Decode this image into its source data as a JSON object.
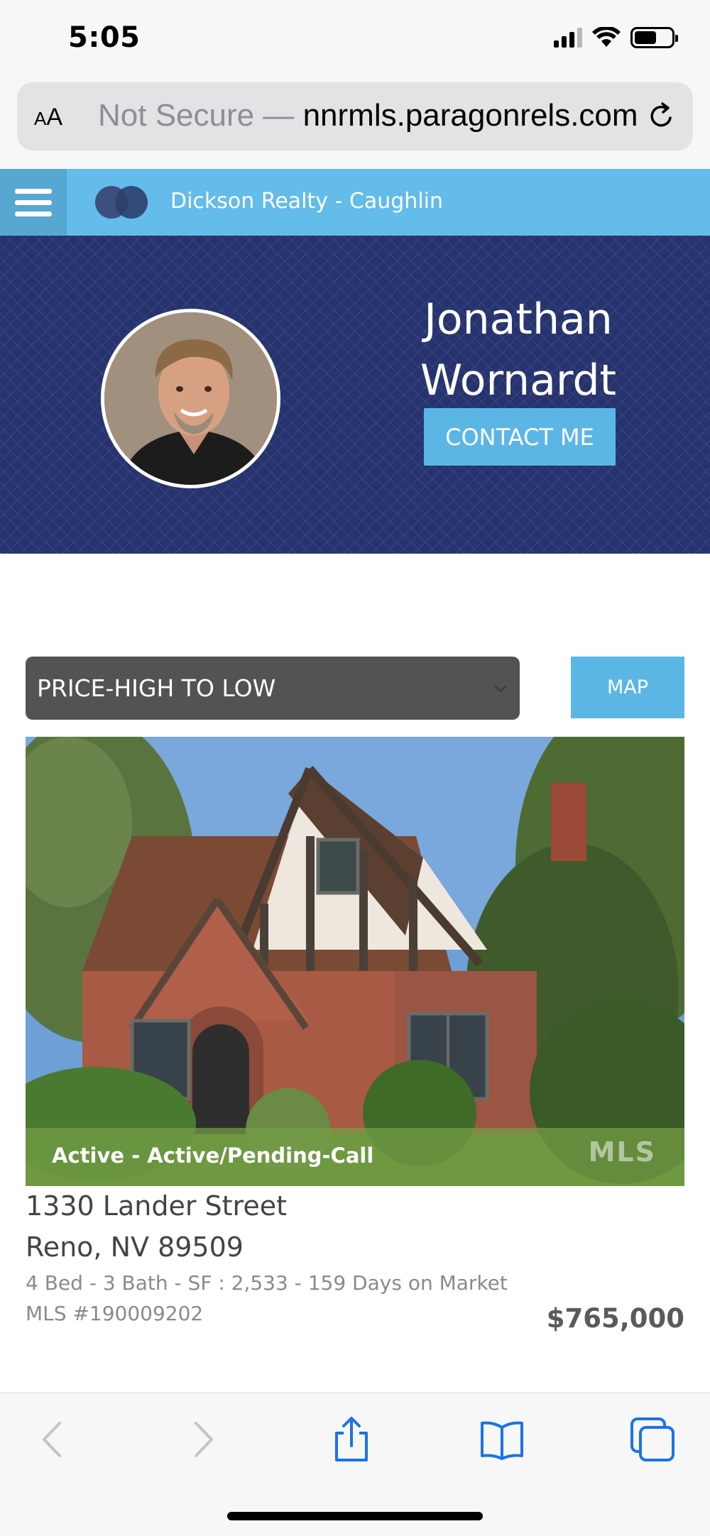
{
  "status_bar": {
    "time": "5:05"
  },
  "browser": {
    "text_size_label_small": "A",
    "text_size_label_large": "A",
    "security_label": "Not Secure —",
    "domain": "nnrmls.paragonrels.com"
  },
  "brand": {
    "name": "Dickson Realty - Caughlin"
  },
  "agent": {
    "name_line1": "Jonathan",
    "name_line2": "Wornardt",
    "contact_label": "CONTACT ME"
  },
  "controls": {
    "sort_value": "PRICE-HIGH TO LOW",
    "map_label": "MAP"
  },
  "listing": {
    "status": "Active - Active/Pending-Call",
    "watermark": "MLS",
    "address_line1": "1330 Lander Street",
    "address_line2": "Reno, NV 89509",
    "details": "4  Bed - 3  Bath - SF : 2,533 - 159 Days on Market",
    "mls_number": "MLS #190009202",
    "price": "$765,000"
  },
  "colors": {
    "brand_bar": "#63bce9",
    "hero_bg": "#26336e",
    "accent_button": "#5bb6e5",
    "ios_blue": "#1a73e8"
  },
  "icons": {
    "toolbar": [
      "back-icon",
      "forward-icon",
      "share-icon",
      "bookmarks-icon",
      "tabs-icon"
    ]
  }
}
